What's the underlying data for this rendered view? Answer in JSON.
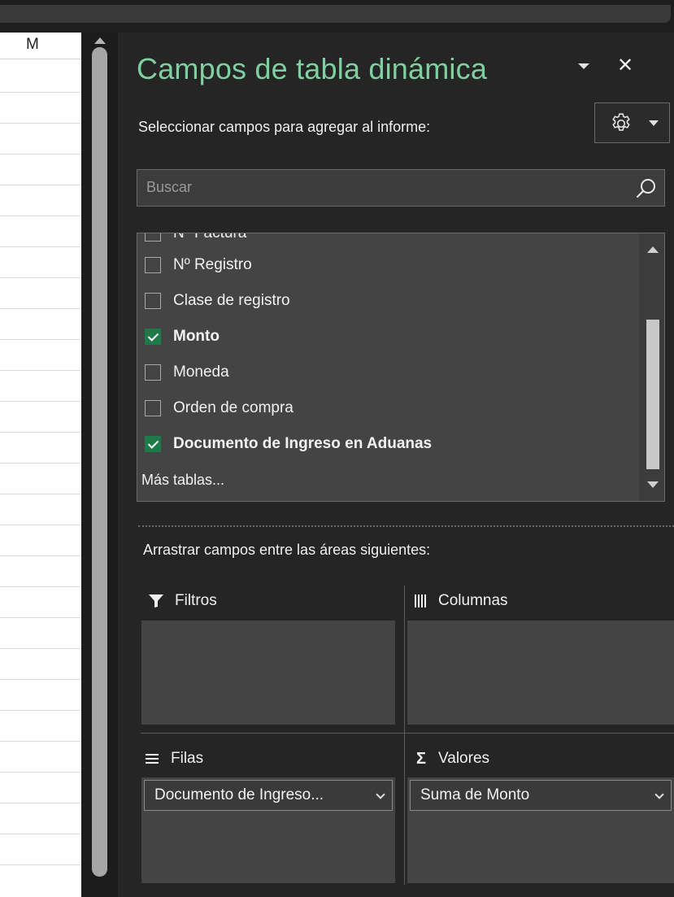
{
  "sheet": {
    "column_header": "M"
  },
  "pane": {
    "title": "Campos de tabla dinámica",
    "subtitle": "Seleccionar campos para agregar al informe:",
    "search_placeholder": "Buscar",
    "fields": [
      {
        "label": "Nº Factura",
        "checked": false,
        "bold": false
      },
      {
        "label": "Nº Registro",
        "checked": false,
        "bold": false
      },
      {
        "label": "Clase de registro",
        "checked": false,
        "bold": false
      },
      {
        "label": "Monto",
        "checked": true,
        "bold": true
      },
      {
        "label": "Moneda",
        "checked": false,
        "bold": false
      },
      {
        "label": "Orden de compra",
        "checked": false,
        "bold": false
      },
      {
        "label": "Documento de Ingreso en Aduanas",
        "checked": true,
        "bold": true
      }
    ],
    "more_tables": "Más tablas...",
    "areas_label": "Arrastrar campos entre las áreas siguientes:",
    "areas": {
      "filters": {
        "label": "Filtros",
        "icon": "filter-icon"
      },
      "columns": {
        "label": "Columnas",
        "icon": "columns-icon"
      },
      "rows": {
        "label": "Filas",
        "icon": "rows-icon",
        "chip": "Documento de Ingreso..."
      },
      "values": {
        "label": "Valores",
        "icon": "sigma-icon",
        "chip": "Suma de Monto"
      }
    },
    "colors": {
      "title": "#7fd0a0",
      "checkbox_checked": "#1f7a4a",
      "pane_bg": "#252525"
    }
  }
}
